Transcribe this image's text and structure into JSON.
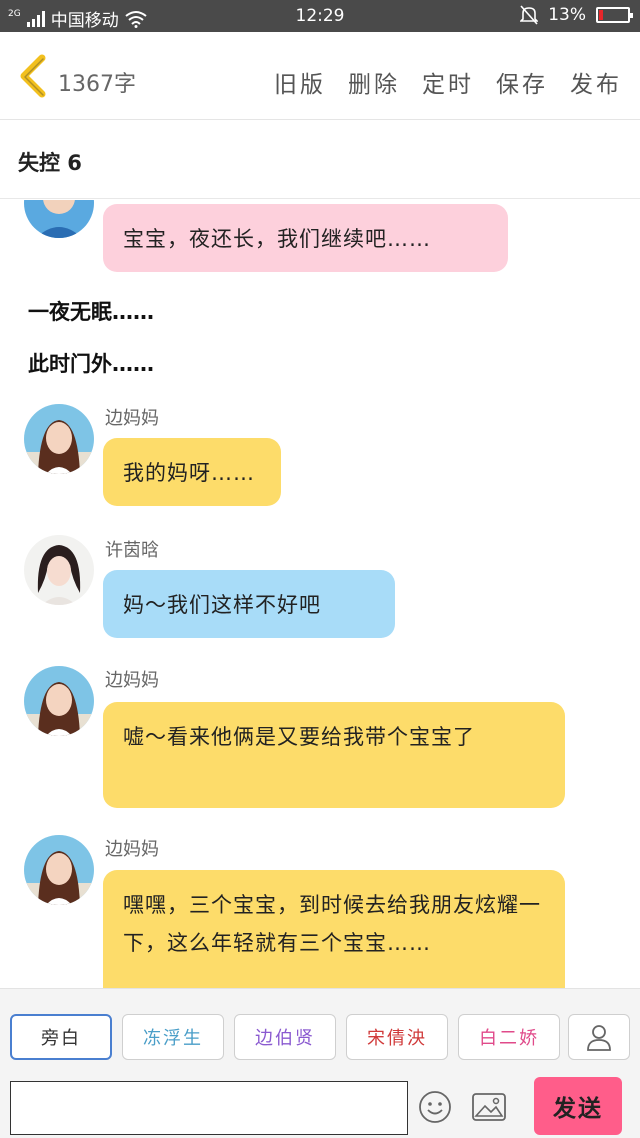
{
  "status_bar": {
    "network_type": "2G",
    "carrier": "中国移动",
    "time": "12:29",
    "battery": "13%",
    "battery_level": 0.13
  },
  "header": {
    "word_count": "1367字",
    "actions": [
      "旧版",
      "删除",
      "定时",
      "保存",
      "发布"
    ]
  },
  "story": {
    "title": "失控 6"
  },
  "chat": {
    "messages": [
      {
        "type": "bubble",
        "color": "pink",
        "text": "宝宝，夜还长，我们继续吧……"
      },
      {
        "type": "narration",
        "text": "一夜无眠……"
      },
      {
        "type": "narration",
        "text": "此时门外……"
      },
      {
        "type": "bubble",
        "speaker": "边妈妈",
        "color": "yellow",
        "text": "我的妈呀……"
      },
      {
        "type": "bubble",
        "speaker": "许茵晗",
        "color": "blue",
        "text": "妈～我们这样不好吧"
      },
      {
        "type": "bubble",
        "speaker": "边妈妈",
        "color": "yellow",
        "text": "嘘～看来他俩是又要给我带个宝宝了"
      },
      {
        "type": "bubble",
        "speaker": "边妈妈",
        "color": "yellow",
        "text": "嘿嘿，三个宝宝，到时候去给我朋友炫耀一下，这么年轻就有三个宝宝……"
      }
    ]
  },
  "bottom": {
    "roles": [
      "旁白",
      "冻浮生",
      "边伯贤",
      "宋倩泱",
      "白二娇"
    ],
    "input_placeholder": "",
    "send_label": "发送"
  },
  "colors": {
    "pink_bubble": "#fdd0dc",
    "yellow_bubble": "#fddc6a",
    "blue_bubble": "#a8dcf8",
    "send_button": "#ff5d8a",
    "back_arrow": "#f2c01e",
    "status_bar": "#4a4a4a"
  }
}
